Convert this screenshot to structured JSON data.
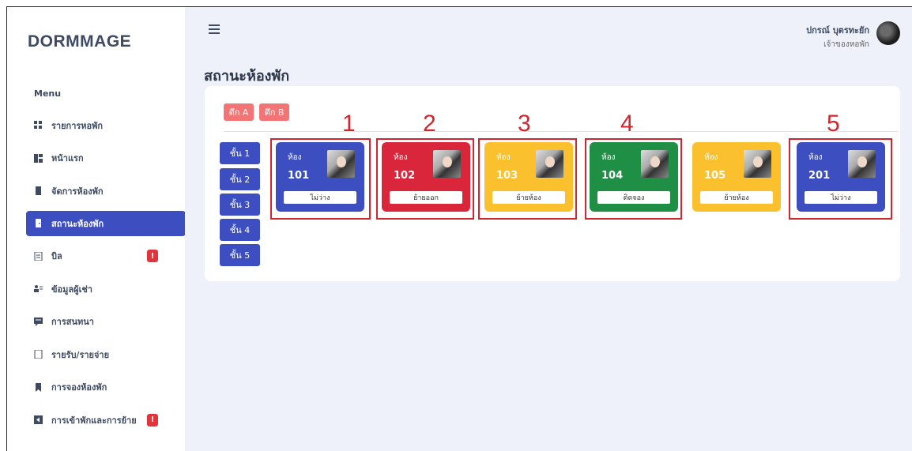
{
  "brand": "DORMMAGE",
  "sidebar": {
    "menu_title": "Menu",
    "items": [
      {
        "label": "รายการหอพัก",
        "icon": "grid-icon"
      },
      {
        "label": "หน้าแรก",
        "icon": "dashboard-icon"
      },
      {
        "label": "จัดการห้องพัก",
        "icon": "door-icon"
      },
      {
        "label": "สถานะห้องพัก",
        "icon": "door-open-icon",
        "active": true
      },
      {
        "label": "บิล",
        "icon": "bill-icon",
        "badge": "!"
      },
      {
        "label": "ข้อมูลผู้เช่า",
        "icon": "users-icon"
      },
      {
        "label": "การสนทนา",
        "icon": "chat-icon"
      },
      {
        "label": "รายรับ/รายจ่าย",
        "icon": "copy-icon"
      },
      {
        "label": "การจองห้องพัก",
        "icon": "bookmark-icon"
      },
      {
        "label": "การเข้าพักและการย้าย",
        "icon": "sign-in-icon",
        "badge": "!"
      }
    ]
  },
  "header": {
    "user_name": "ปกรณ์ บุตรทะยัก",
    "user_role": "เจ้าของหอพัก"
  },
  "page_title": "สถานะห้องพัก",
  "building_tabs": [
    "ตึก A",
    "ตึก B"
  ],
  "floors": [
    "ชั้น 1",
    "ชั้น 2",
    "ชั้น 3",
    "ชั้น 4",
    "ชั้น 5"
  ],
  "rooms": [
    {
      "label": "ห้อง",
      "number": "101",
      "status": "ไม่ว่าง",
      "color": "#3d4fc0"
    },
    {
      "label": "ห้อง",
      "number": "102",
      "status": "ย้ายออก",
      "color": "#d9263a"
    },
    {
      "label": "ห้อง",
      "number": "103",
      "status": "ย้ายห้อง",
      "color": "#fbc02d"
    },
    {
      "label": "ห้อง",
      "number": "104",
      "status": "ติดจอง",
      "color": "#1e8f44"
    },
    {
      "label": "ห้อง",
      "number": "105",
      "status": "ย้ายห้อง",
      "color": "#fbc02d"
    },
    {
      "label": "ห้อง",
      "number": "201",
      "status": "ไม่ว่าง",
      "color": "#3d4fc0"
    }
  ],
  "annotations": [
    "1",
    "2",
    "3",
    "4",
    "5"
  ],
  "colors": {
    "accent": "#3d4fc0",
    "tab": "#f27474",
    "highlight": "#d0262f",
    "background": "#eef1fa"
  }
}
